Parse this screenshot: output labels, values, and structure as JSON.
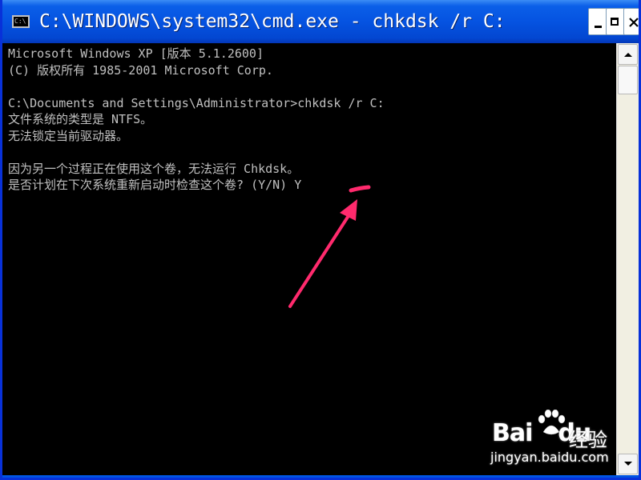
{
  "window": {
    "title": "C:\\WINDOWS\\system32\\cmd.exe - chkdsk /r C:"
  },
  "console": {
    "lines": [
      "Microsoft Windows XP [版本 5.1.2600]",
      "(C) 版权所有 1985-2001 Microsoft Corp.",
      "",
      "C:\\Documents and Settings\\Administrator>chkdsk /r C:",
      "文件系统的类型是 NTFS。",
      "无法锁定当前驱动器。",
      "",
      "因为另一个过程正在使用这个卷，无法运行 Chkdsk。",
      "是否计划在下次系统重新启动时检查这个卷? (Y/N) Y"
    ]
  },
  "annotation": {
    "color": "#ff2a6d"
  },
  "watermark": {
    "brand_prefix": "Bai",
    "brand_suffix": "du",
    "product": "经验",
    "url": "jingyan.baidu.com"
  },
  "icons": {
    "app": "cmd-app-icon",
    "minimize": "minimize-icon",
    "maximize": "maximize-icon",
    "close": "close-icon",
    "scroll_up": "arrow-up-icon",
    "scroll_down": "arrow-down-icon",
    "arrow": "annotation-arrow-icon",
    "paw": "baidu-paw-icon"
  }
}
